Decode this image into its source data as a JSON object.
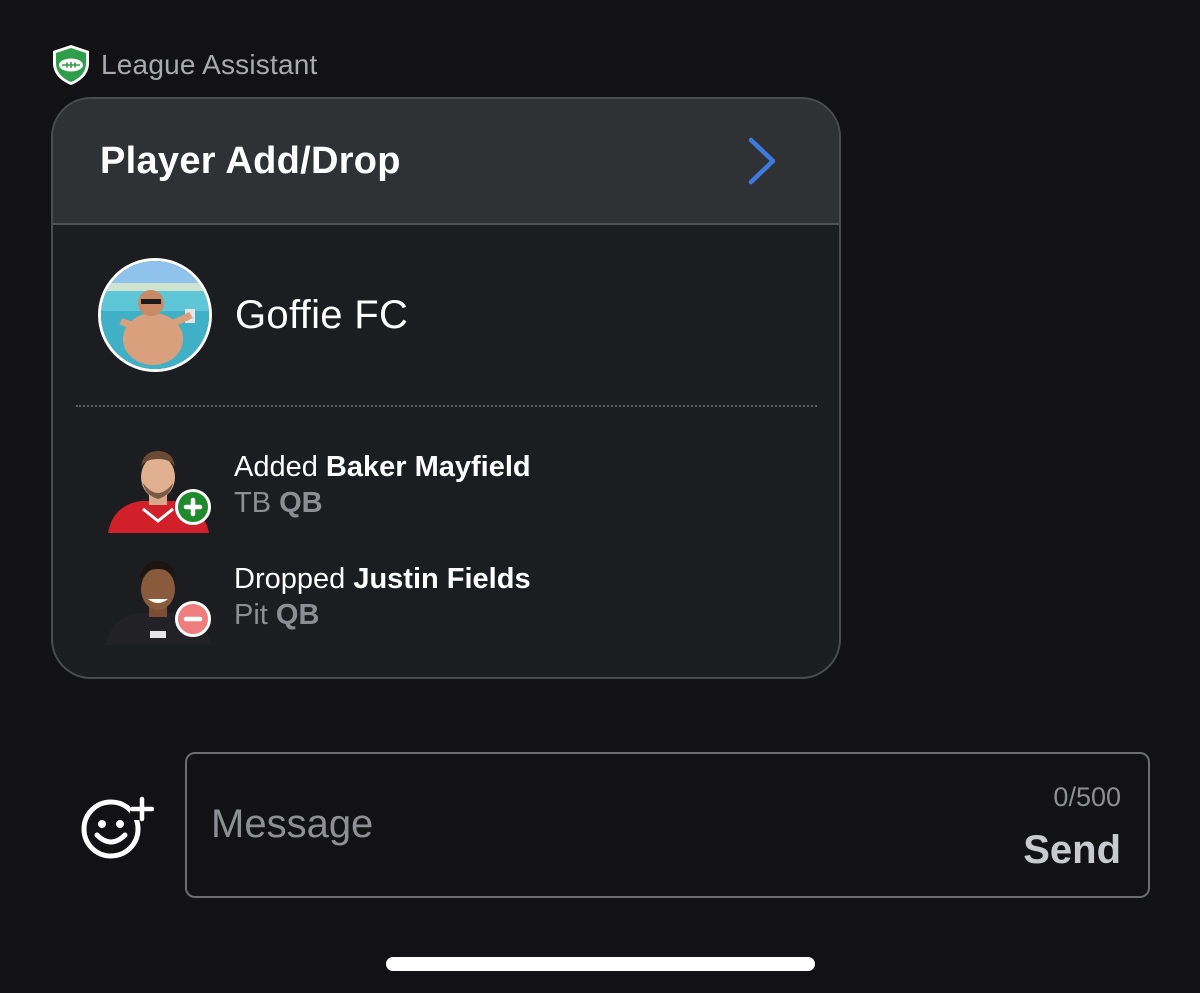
{
  "sender": {
    "icon": "league-shield-football-icon",
    "name": "League Assistant"
  },
  "card": {
    "title": "Player Add/Drop",
    "chevron_icon": "chevron-right-icon",
    "team": {
      "name": "Goffie FC",
      "avatar": "team-avatar-photo"
    },
    "moves": [
      {
        "action": "Added",
        "player": "Baker Mayfield",
        "team": "TB",
        "position": "QB",
        "badge_icon": "plus-circle-icon",
        "badge_color": "#1f8a2c"
      },
      {
        "action": "Dropped",
        "player": "Justin Fields",
        "team": "Pit",
        "position": "QB",
        "badge_icon": "minus-circle-icon",
        "badge_color": "#f07d7d"
      }
    ]
  },
  "composer": {
    "emoji_icon": "add-emoji-icon",
    "placeholder": "Message",
    "value": "",
    "char_count": "0/500",
    "send_label": "Send"
  },
  "colors": {
    "accent": "#3b7be0",
    "background": "#121214",
    "card_header": "#303135"
  }
}
